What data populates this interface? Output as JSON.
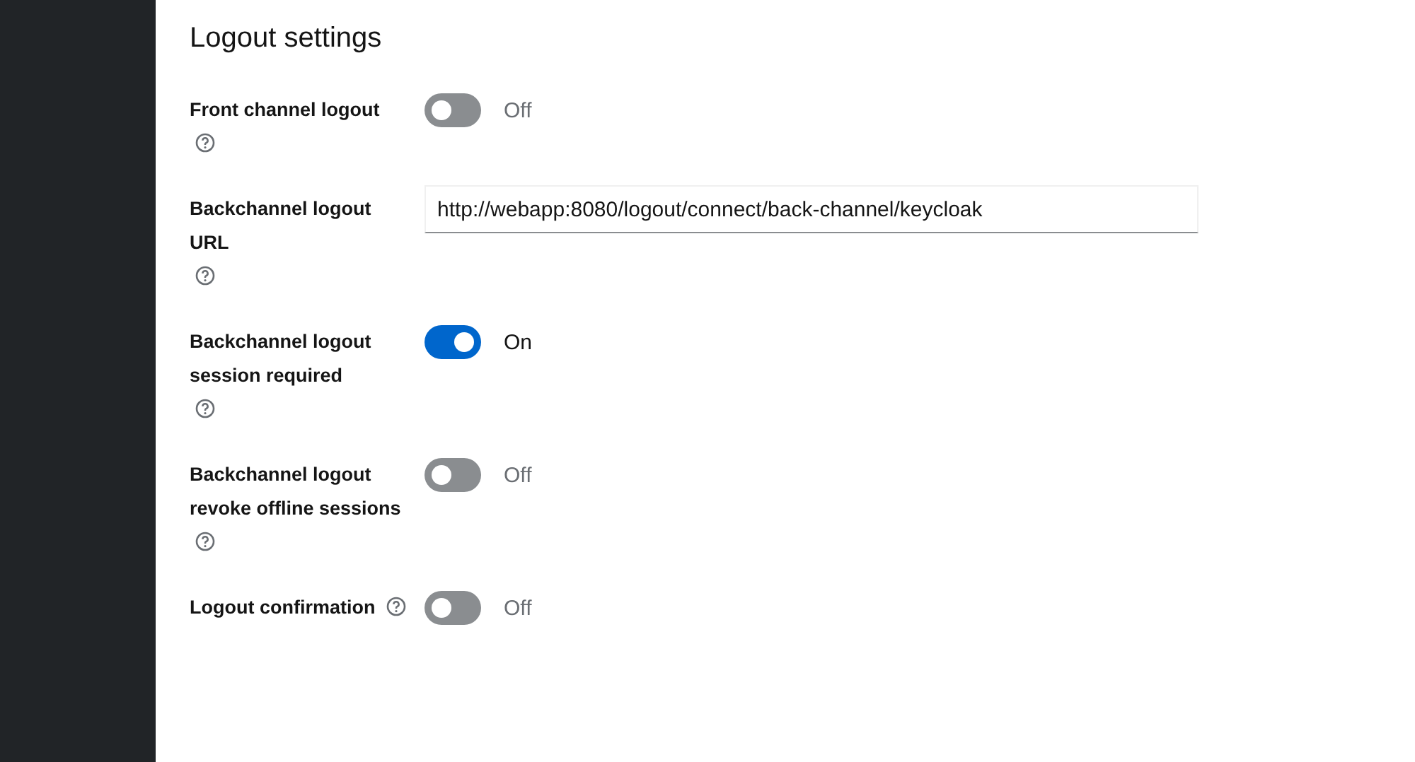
{
  "section": {
    "title": "Logout settings"
  },
  "fields": [
    {
      "kind": "switch",
      "label": "Front channel logout",
      "on": false,
      "state_text": "Off"
    },
    {
      "kind": "text",
      "label": "Backchannel logout URL",
      "value": "http://webapp:8080/logout/connect/back-channel/keycloak"
    },
    {
      "kind": "switch",
      "label": "Backchannel logout session required",
      "on": true,
      "state_text": "On"
    },
    {
      "kind": "switch",
      "label": "Backchannel logout revoke offline sessions",
      "on": false,
      "state_text": "Off"
    },
    {
      "kind": "switch",
      "label": "Logout confirmation",
      "on": false,
      "state_text": "Off"
    }
  ]
}
